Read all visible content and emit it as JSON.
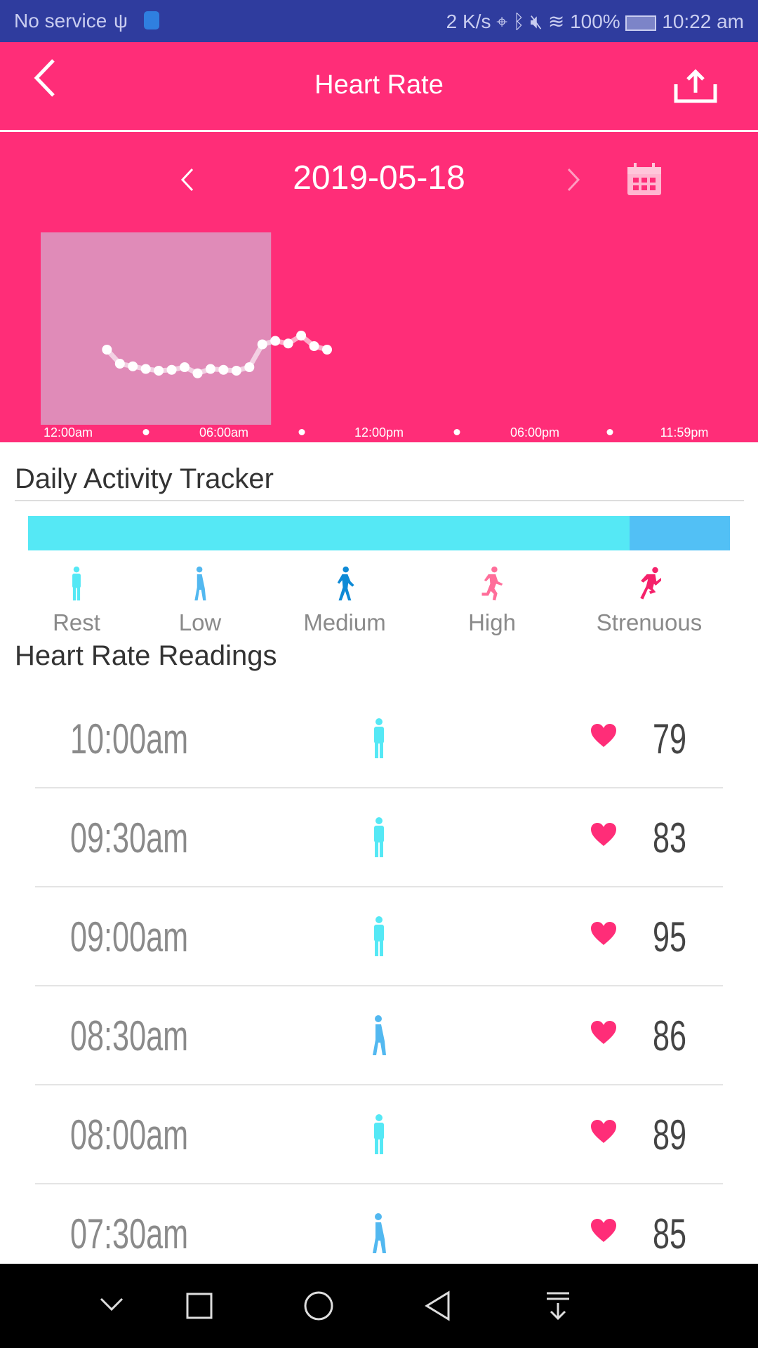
{
  "status_bar": {
    "carrier": "No service",
    "speed": "2 K/s",
    "battery": "100%",
    "time": "10:22 am"
  },
  "header": {
    "title": "Heart Rate",
    "back_icon": "chevron-left-icon",
    "share_icon": "upload-icon"
  },
  "date_nav": {
    "date": "2019-05-18",
    "prev_icon": "chevron-left-icon",
    "next_icon": "chevron-right-icon",
    "calendar_icon": "calendar-icon"
  },
  "chart_data": {
    "type": "line",
    "x_ticks": [
      "12:00am",
      "06:00am",
      "12:00pm",
      "06:00pm",
      "11:59pm"
    ],
    "x_range": [
      "12:00am",
      "11:59pm"
    ],
    "highlight_range": [
      "12:00am",
      "08:00am"
    ],
    "x": [
      "01:30am",
      "02:00am",
      "02:30am",
      "03:00am",
      "03:30am",
      "04:00am",
      "04:30am",
      "05:00am",
      "05:30am",
      "06:00am",
      "06:30am",
      "07:00am",
      "07:30am",
      "08:00am",
      "08:30am",
      "09:00am",
      "09:30am",
      "10:00am"
    ],
    "values": [
      79,
      63,
      60,
      57,
      55,
      56,
      59,
      52,
      57,
      56,
      55,
      59,
      85,
      89,
      86,
      95,
      83,
      79
    ],
    "colors": {
      "background": "#ff2d78",
      "highlight": "#e08bb8",
      "line": "#ffffff"
    }
  },
  "activity": {
    "title": "Daily Activity Tracker",
    "bar": [
      {
        "level": "Rest",
        "fraction": 0.857,
        "color": "#55e8f5"
      },
      {
        "level": "Low",
        "fraction": 0.143,
        "color": "#52c0f5"
      }
    ],
    "levels": [
      {
        "label": "Rest",
        "icon": "standing-person-icon",
        "color": "#55e8f5"
      },
      {
        "label": "Low",
        "icon": "walking-person-icon",
        "color": "#52b8f0"
      },
      {
        "label": "Medium",
        "icon": "walking-fast-person-icon",
        "color": "#0e8ad6"
      },
      {
        "label": "High",
        "icon": "running-person-icon",
        "color": "#ff6e9a"
      },
      {
        "label": "Strenuous",
        "icon": "sprinting-person-icon",
        "color": "#f5226b"
      }
    ]
  },
  "readings": {
    "title": "Heart Rate Readings",
    "rows": [
      {
        "time": "10:00am",
        "level": "Rest",
        "bpm": "79"
      },
      {
        "time": "09:30am",
        "level": "Rest",
        "bpm": "83"
      },
      {
        "time": "09:00am",
        "level": "Rest",
        "bpm": "95"
      },
      {
        "time": "08:30am",
        "level": "Low",
        "bpm": "86"
      },
      {
        "time": "08:00am",
        "level": "Rest",
        "bpm": "89"
      },
      {
        "time": "07:30am",
        "level": "Low",
        "bpm": "85"
      }
    ]
  },
  "nav_bar": {
    "icons": [
      "chevron-down-icon",
      "square-icon",
      "circle-icon",
      "triangle-back-icon",
      "notification-down-icon"
    ]
  }
}
